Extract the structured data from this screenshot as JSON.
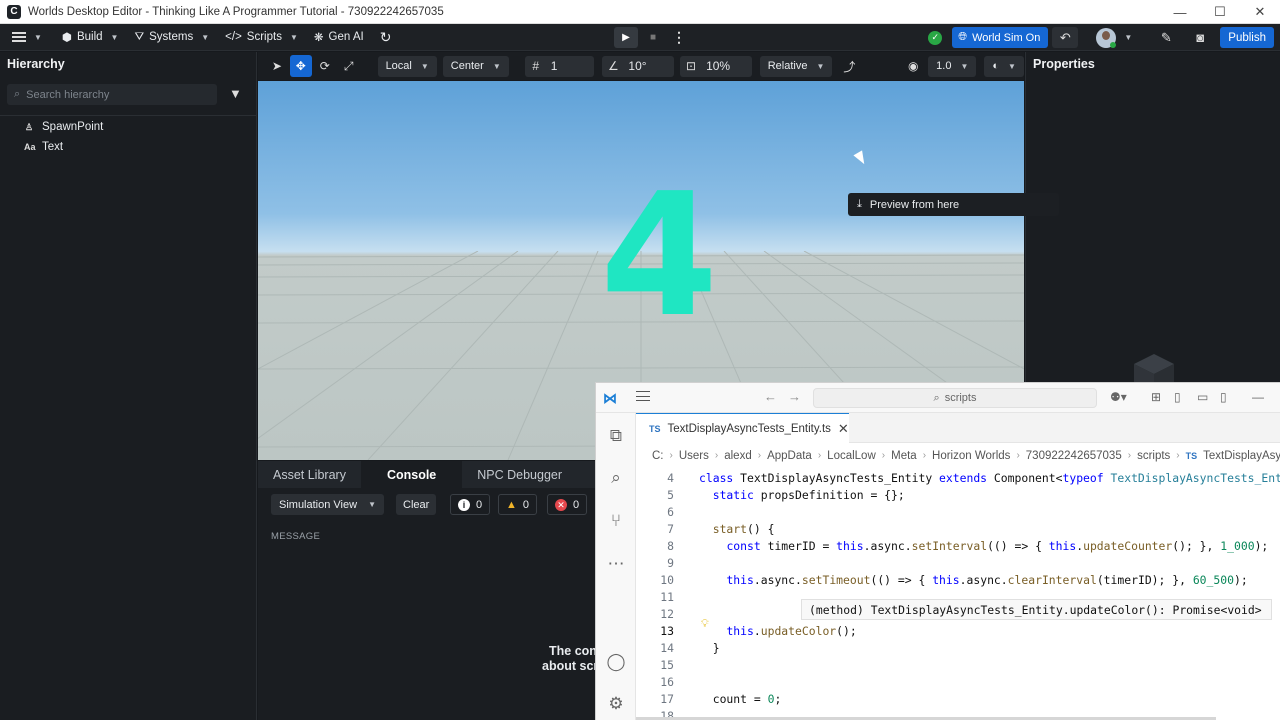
{
  "window": {
    "title": "Worlds Desktop Editor - Thinking Like A Programmer Tutorial - 730922242657035",
    "minimize": "—",
    "maximize": "☐",
    "close": "✕"
  },
  "toolbar": {
    "build": "Build",
    "systems": "Systems",
    "scripts": "Scripts",
    "gen_ai": "Gen AI",
    "world_sim": "World Sim On",
    "publish": "Publish"
  },
  "hierarchy": {
    "title": "Hierarchy",
    "search_placeholder": "Search hierarchy",
    "items": [
      {
        "icon": "spawn-point-icon",
        "label": "SpawnPoint"
      },
      {
        "icon": "text-icon",
        "label": "Text",
        "glyph": "Aa"
      }
    ]
  },
  "viewport_toolbar": {
    "space": "Local",
    "pivot": "Center",
    "grid_snap": "1",
    "rotation_snap": "10°",
    "scale_snap": "10%",
    "mode": "Relative",
    "camera_speed": "1.0"
  },
  "viewport": {
    "display_text": "4",
    "text_color": "#1fe6c2",
    "context_tooltip": "Preview from here"
  },
  "properties": {
    "title": "Properties"
  },
  "bottom_panel": {
    "tabs": [
      "Asset Library",
      "Console",
      "NPC Debugger"
    ],
    "active_tab": "Console",
    "view_select": "Simulation View",
    "clear": "Clear",
    "info_count": "0",
    "warning_count": "0",
    "error_count": "0",
    "message_header": "MESSAGE",
    "empty_text_1": "The con",
    "empty_text_2": "about scr"
  },
  "vscode": {
    "search_text": "scripts",
    "tab_lang": "TS",
    "tab_title": "TextDisplayAsyncTests_Entity.ts",
    "breadcrumbs": [
      "C:",
      "Users",
      "alexd",
      "AppData",
      "LocalLow",
      "Meta",
      "Horizon Worlds",
      "730922242657035",
      "scripts",
      "TextDisplayAsyncT"
    ],
    "line_numbers": [
      "4",
      "5",
      "6",
      "7",
      "8",
      "9",
      "10",
      "11",
      "12",
      "13",
      "14",
      "15",
      "16",
      "17",
      "18"
    ],
    "current_line": "13",
    "lines": [
      "class TextDisplayAsyncTests_Entity extends Component<typeof TextDisplayAsyncTests_Ent",
      "  static propsDefinition = {};",
      "",
      "  start() {",
      "    const timerID = this.async.setInterval(() => { this.updateCounter(); }, 1_000);",
      "",
      "    this.async.setTimeout(() => { this.async.clearInterval(timerID); }, 60_500);",
      "",
      "",
      "    this.updateColor();",
      "  }",
      "",
      "",
      "  count = 0;",
      ""
    ],
    "hover_text": "(method) TextDisplayAsyncTests_Entity.updateColor(): Promise<void>"
  }
}
